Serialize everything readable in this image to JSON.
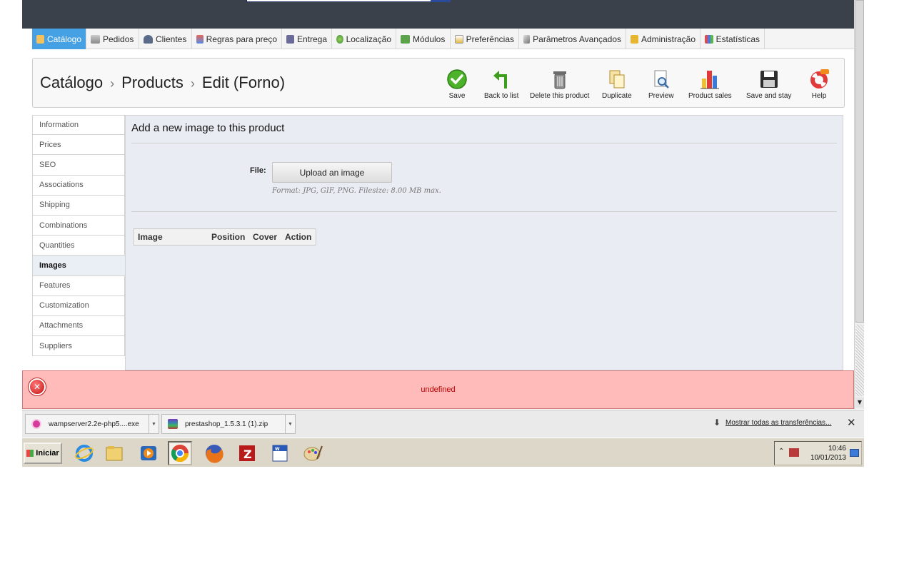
{
  "menu": {
    "items": [
      {
        "label": "Catálogo",
        "icon": "folder-icon"
      },
      {
        "label": "Pedidos",
        "icon": "cart-icon"
      },
      {
        "label": "Clientes",
        "icon": "user-icon"
      },
      {
        "label": "Regras para preço",
        "icon": "price-rules-icon"
      },
      {
        "label": "Entrega",
        "icon": "truck-icon"
      },
      {
        "label": "Localização",
        "icon": "globe-icon"
      },
      {
        "label": "Módulos",
        "icon": "puzzle-icon"
      },
      {
        "label": "Preferências",
        "icon": "preferences-icon"
      },
      {
        "label": "Parâmetros Avançados",
        "icon": "wrench-icon"
      },
      {
        "label": "Administração",
        "icon": "key-icon"
      },
      {
        "label": "Estatísticas",
        "icon": "bar-chart-icon"
      }
    ],
    "active_index": 0
  },
  "breadcrumb": {
    "level1": "Catálogo",
    "level2": "Products",
    "level3": "Edit (Forno)",
    "separator": "›"
  },
  "toolbar": {
    "save": "Save",
    "back": "Back to list",
    "delete": "Delete this product",
    "duplicate": "Duplicate",
    "preview": "Preview",
    "sales": "Product sales",
    "save_stay": "Save and stay",
    "help": "Help"
  },
  "tabs": [
    "Information",
    "Prices",
    "SEO",
    "Associations",
    "Shipping",
    "Combinations",
    "Quantities",
    "Images",
    "Features",
    "Customization",
    "Attachments",
    "Suppliers"
  ],
  "active_tab": "Images",
  "content": {
    "heading": "Add a new image to this product",
    "file_label": "File:",
    "upload_button": "Upload an image",
    "hint": "Format: JPG, GIF, PNG. Filesize: 8.00 MB max.",
    "table_headers": [
      "Image",
      "Position",
      "Cover",
      "Action"
    ]
  },
  "error": {
    "message": "undefined"
  },
  "downloads": {
    "items": [
      {
        "name": "wampserver2.2e-php5....exe",
        "icon": "wampserver-icon"
      },
      {
        "name": "prestashop_1.5.3.1 (1).zip",
        "icon": "winrar-icon"
      }
    ],
    "show_all": "Mostrar todas as transferências..."
  },
  "taskbar": {
    "start_label": "Iniciar",
    "apps": [
      "internet-explorer-icon",
      "file-explorer-icon",
      "media-player-icon",
      "chrome-icon",
      "firefox-icon",
      "filezilla-icon",
      "word-icon",
      "paint-icon"
    ],
    "clock_time": "10:46",
    "clock_date": "10/01/2013"
  },
  "colors": {
    "menu_active": "#45a1e4",
    "error_bg": "#ffbaba",
    "error_text": "#c00000",
    "header_dark": "#3b414a"
  }
}
